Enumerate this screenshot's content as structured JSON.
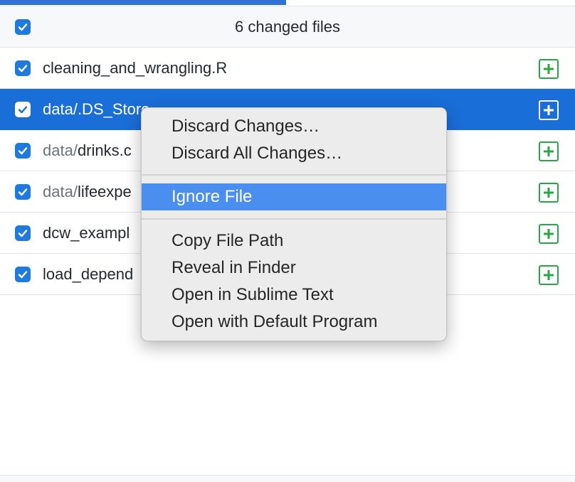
{
  "header": {
    "title": "6 changed files",
    "select_all_checked": true
  },
  "files": [
    {
      "dir": "",
      "name": "cleaning_and_wrangling.R",
      "checked": true,
      "status": "added",
      "selected": false
    },
    {
      "dir": "data/",
      "name": ".DS_Store",
      "checked": true,
      "status": "added",
      "selected": true
    },
    {
      "dir": "data/",
      "name": "drinks.c",
      "checked": true,
      "status": "added",
      "selected": false
    },
    {
      "dir": "data/",
      "name": "lifeexpe",
      "checked": true,
      "status": "added",
      "selected": false
    },
    {
      "dir": "",
      "name": "dcw_exampl",
      "checked": true,
      "status": "added",
      "selected": false
    },
    {
      "dir": "",
      "name": "load_depend",
      "checked": true,
      "status": "added",
      "selected": false
    }
  ],
  "context_menu": {
    "items": [
      "Discard Changes…",
      "Discard All Changes…",
      "Ignore File",
      "Copy File Path",
      "Reveal in Finder",
      "Open in Sublime Text",
      "Open with Default Program"
    ],
    "highlighted": "Ignore File"
  },
  "colors": {
    "accent": "#1a6ed8",
    "added": "#28a745",
    "menu_highlight": "#4a8ff0"
  }
}
